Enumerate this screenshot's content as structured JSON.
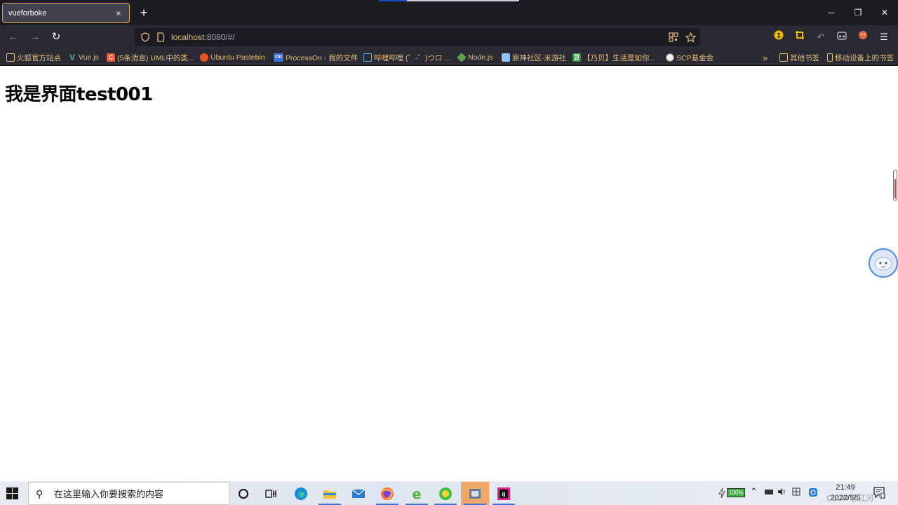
{
  "browser": {
    "tab_title": "vueforboke",
    "tab_close": "×",
    "new_tab": "+",
    "window_controls": {
      "minimize": "─",
      "restore": "❐",
      "close": "✕"
    },
    "url_host": "localhost",
    "url_rest": ":8080/#/",
    "nav": {
      "back": "←",
      "forward": "→",
      "reload": "↻"
    }
  },
  "bookmarks": [
    {
      "label": "火狐官方站点",
      "icon": "folder-icon"
    },
    {
      "label": "Vue.js",
      "icon": "vue-icon"
    },
    {
      "label": "(5条消息) UML中的类...",
      "icon": "csdn-icon"
    },
    {
      "label": "Ubuntu Pastebin",
      "icon": "ubuntu-icon"
    },
    {
      "label": "ProcessOn - 我的文件",
      "icon": "processon-icon"
    },
    {
      "label": "哔哩哔哩 (゜-゜)つロ ...",
      "icon": "bilibili-icon"
    },
    {
      "label": "Node.js",
      "icon": "node-icon"
    },
    {
      "label": "原神社区-米游社",
      "icon": "miyoushe-icon"
    },
    {
      "label": "【乃贝】生活是如你...",
      "icon": "douban-icon"
    },
    {
      "label": "SCP基金会",
      "icon": "scp-icon"
    }
  ],
  "bookmarks_more": "»",
  "bookmarks_other": "其他书签",
  "bookmarks_mobile": "移动设备上的书签",
  "page": {
    "heading": "我是界面test001"
  },
  "taskbar": {
    "search_placeholder": "在这里输入你要搜索的内容",
    "battery": "100%",
    "time": "21:49",
    "date": "2022/5/5",
    "watermark": "CSDN @江河",
    "notification_count": "13"
  }
}
